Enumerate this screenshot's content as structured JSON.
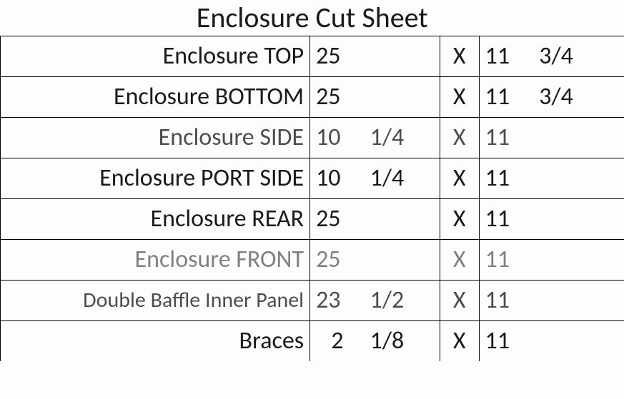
{
  "title": "Enclosure Cut Sheet",
  "bySymbol": "X",
  "rows": [
    {
      "label": "Enclosure TOP",
      "a_whole": "25",
      "a_frac": "",
      "b_whole": "11",
      "b_frac": "3/4"
    },
    {
      "label": "Enclosure BOTTOM",
      "a_whole": "25",
      "a_frac": "",
      "b_whole": "11",
      "b_frac": "3/4"
    },
    {
      "label": "Enclosure SIDE",
      "a_whole": "10",
      "a_frac": "1/4",
      "b_whole": "11",
      "b_frac": ""
    },
    {
      "label": "Enclosure PORT SIDE",
      "a_whole": "10",
      "a_frac": "1/4",
      "b_whole": "11",
      "b_frac": ""
    },
    {
      "label": "Enclosure REAR",
      "a_whole": "25",
      "a_frac": "",
      "b_whole": "11",
      "b_frac": ""
    },
    {
      "label": "Enclosure FRONT",
      "a_whole": "25",
      "a_frac": "",
      "b_whole": "11",
      "b_frac": ""
    },
    {
      "label": "Double Baffle Inner Panel",
      "a_whole": "23",
      "a_frac": "1/2",
      "b_whole": "11",
      "b_frac": ""
    },
    {
      "label": "Braces",
      "a_whole": "2",
      "a_frac": "1/8",
      "b_whole": "11",
      "b_frac": ""
    }
  ]
}
